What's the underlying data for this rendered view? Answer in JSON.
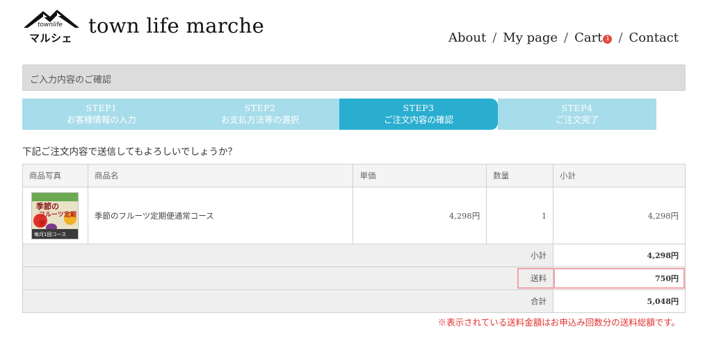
{
  "logo": {
    "small": "townlife",
    "sub": "マルシェ"
  },
  "site_title": "town life marche",
  "nav": {
    "about": "About",
    "mypage": "My page",
    "cart": "Cart",
    "cart_count": "1",
    "contact": "Contact",
    "separator": "/"
  },
  "section_title": "ご入力内容のご確認",
  "steps": [
    {
      "num": "STEP1",
      "label": "お客様情報の入力"
    },
    {
      "num": "STEP2",
      "label": "お支払方法等の選択"
    },
    {
      "num": "STEP3",
      "label": "ご注文内容の確認"
    },
    {
      "num": "STEP4",
      "label": "ご注文完了"
    }
  ],
  "question": "下記ご注文内容で送信してもよろしいでしょうか？",
  "table": {
    "headers": [
      "商品写真",
      "商品名",
      "単価",
      "数量",
      "小計"
    ],
    "item": {
      "image_text": {
        "line1": "季節の",
        "line2": "フルーツ定期便",
        "line3": "毎月1回コース"
      },
      "name": "季節のフルーツ定期便通常コース",
      "price": "4,298円",
      "qty": "1",
      "subtotal": "4,298円"
    },
    "summary": [
      {
        "label": "小計",
        "value": "4,298円"
      },
      {
        "label": "送料",
        "value": "750円"
      },
      {
        "label": "合計",
        "value": "5,048円"
      }
    ]
  },
  "note": "※表示されている送料金額はお申込み回数分の送料総額です。",
  "colors": {
    "step": "#a7dcea",
    "step_active": "#29aed0",
    "note": "#e32f2f",
    "highlight": "#f2a2a7",
    "badge": "#e34b3d"
  }
}
